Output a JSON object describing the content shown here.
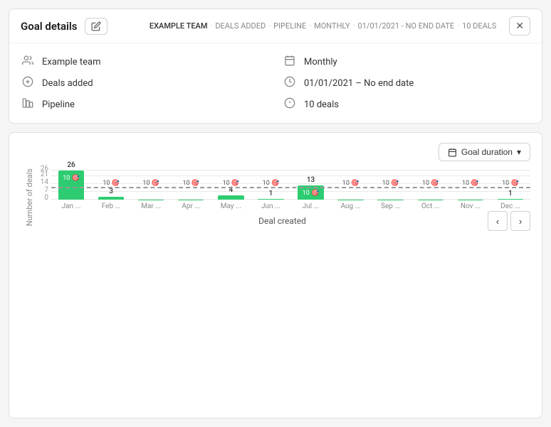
{
  "header": {
    "title": "Goal details",
    "edit_tooltip": "Edit",
    "breadcrumb": [
      "EXAMPLE TEAM",
      "·",
      "DEALS ADDED",
      "·",
      "PIPELINE",
      "·",
      "MONTHLY",
      "·",
      "01/01/2021 - NO END DATE",
      "·",
      "10 DEALS"
    ],
    "close_label": "✕"
  },
  "details": {
    "left": [
      {
        "icon": "👥",
        "label": "Example team",
        "name": "team"
      },
      {
        "icon": "⊙",
        "label": "Deals added",
        "name": "deals-added"
      },
      {
        "icon": "⊞",
        "label": "Pipeline",
        "name": "pipeline"
      }
    ],
    "right": [
      {
        "icon": "📅",
        "label": "Monthly",
        "name": "monthly"
      },
      {
        "icon": "🕐",
        "label": "01/01/2021 – No end date",
        "name": "date-range"
      },
      {
        "icon": "🎯",
        "label": "10 deals",
        "name": "deals-count"
      }
    ]
  },
  "chart": {
    "goal_duration_btn": "Goal duration",
    "y_axis_label": "Number of deals",
    "x_axis_title": "Deal created",
    "goal_value": 10,
    "goal_label": "10 🎯",
    "y_ticks": [
      0,
      7,
      14,
      21,
      26
    ],
    "bars": [
      {
        "month": "Jan ...",
        "value": 26,
        "show_goal": true
      },
      {
        "month": "Feb ...",
        "value": 3,
        "show_goal": true
      },
      {
        "month": "Mar ...",
        "value": 0,
        "show_goal": true
      },
      {
        "month": "Apr ...",
        "value": 0,
        "show_goal": true
      },
      {
        "month": "May ...",
        "value": 4,
        "show_goal": true
      },
      {
        "month": "Jun ...",
        "value": 1,
        "show_goal": true
      },
      {
        "month": "Jul ...",
        "value": 13,
        "show_goal": true
      },
      {
        "month": "Aug ...",
        "value": 0,
        "show_goal": true
      },
      {
        "month": "Sep ...",
        "value": 0,
        "show_goal": true
      },
      {
        "month": "Oct ...",
        "value": 0,
        "show_goal": true
      },
      {
        "month": "Nov ...",
        "value": 0,
        "show_goal": true
      },
      {
        "month": "Dec ...",
        "value": 1,
        "show_goal": true
      }
    ],
    "max_value": 28,
    "nav": {
      "prev": "‹",
      "next": "›"
    }
  }
}
